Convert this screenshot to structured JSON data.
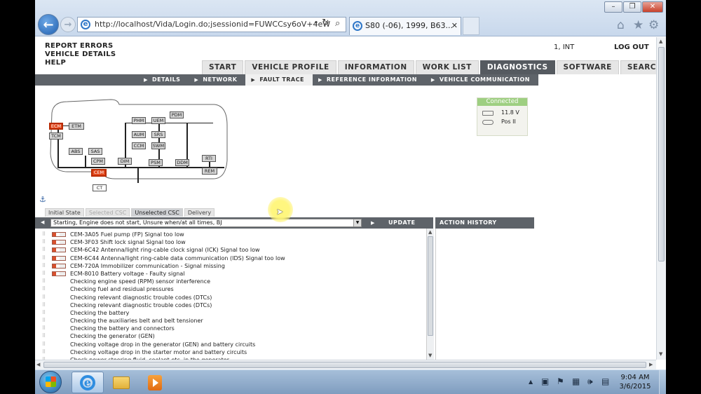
{
  "browser": {
    "address": "http://localhost/Vida/Login.do;jsessionid=FUWCCsy6oV+4eW",
    "tab_title": "S80 (-06), 1999, B63...",
    "window_controls": [
      "minimize",
      "restore",
      "close"
    ]
  },
  "app": {
    "top_links": [
      "REPORT ERRORS",
      "VEHICLE DETAILS",
      "HELP"
    ],
    "user": "1, INT",
    "logout": "LOG OUT",
    "main_tabs": [
      "START",
      "VEHICLE PROFILE",
      "INFORMATION",
      "WORK LIST",
      "DIAGNOSTICS",
      "SOFTWARE",
      "SEARCH"
    ],
    "active_main_tab": "DIAGNOSTICS",
    "sub_tabs": [
      "DETAILS",
      "NETWORK",
      "FAULT TRACE",
      "REFERENCE INFORMATION",
      "VEHICLE COMMUNICATION"
    ],
    "active_sub_tab": "FAULT TRACE"
  },
  "network": {
    "modules": [
      "ECM",
      "ETM",
      "TCM",
      "PHM",
      "UEM",
      "PDM",
      "AUM",
      "SRS",
      "CCM",
      "SWM",
      "ABS",
      "SAS",
      "CPM",
      "CEM",
      "DIM",
      "PSM",
      "DDM",
      "RTI",
      "REM",
      "CT"
    ],
    "fault_modules": [
      "ECM",
      "CEM"
    ],
    "fault_color": "#e24a1f"
  },
  "connection": {
    "status": "Connected",
    "voltage": "11.8 V",
    "ignition": "Pos II",
    "status_color": "#9ecf81"
  },
  "fault_trace": {
    "state_tabs": [
      "Initial State",
      "Selected CSC",
      "Unselected CSC",
      "Delivery"
    ],
    "active_state_tab": "Unselected CSC",
    "symptom": "Starting, Engine does not start, Unsure when/at all times, BJ",
    "update_label": "UPDATE",
    "history_label": "ACTION HISTORY",
    "items": [
      {
        "text": "CEM-3A05 Fuel pump (FP) Signal too low",
        "dtc": true
      },
      {
        "text": "CEM-3F03 Shift lock signal Signal too low",
        "dtc": true
      },
      {
        "text": "CEM-6C42 Antenna/light ring-cable clock signal (ICK) Signal too low",
        "dtc": true
      },
      {
        "text": "CEM-6C44 Antenna/light ring-cable data communication (IDS) Signal too low",
        "dtc": true
      },
      {
        "text": "CEM-720A Immobilizer communication - Signal missing",
        "dtc": true
      },
      {
        "text": "ECM-8010 Battery voltage - Faulty signal",
        "dtc": true
      },
      {
        "text": "Checking engine speed (RPM) sensor interference",
        "dtc": false
      },
      {
        "text": "Checking fuel and residual pressures",
        "dtc": false
      },
      {
        "text": "Checking relevant diagnostic trouble codes (DTCs)",
        "dtc": false
      },
      {
        "text": "Checking relevant diagnostic trouble codes (DTCs)",
        "dtc": false
      },
      {
        "text": "Checking the battery",
        "dtc": false
      },
      {
        "text": "Checking the auxiliaries belt and belt tensioner",
        "dtc": false
      },
      {
        "text": "Checking the battery and connectors",
        "dtc": false
      },
      {
        "text": "Checking the generator (GEN)",
        "dtc": false
      },
      {
        "text": "Checking voltage drop in the generator (GEN) and battery circuits",
        "dtc": false
      },
      {
        "text": "Checking voltage drop in the starter motor and battery circuits",
        "dtc": false
      },
      {
        "text": "Check power steering fluid, coolant etc. in the generator",
        "dtc": false
      }
    ]
  },
  "taskbar": {
    "time": "9:04 AM",
    "date": "3/6/2015",
    "apps": [
      "internet-explorer",
      "file-explorer",
      "media-player"
    ]
  }
}
